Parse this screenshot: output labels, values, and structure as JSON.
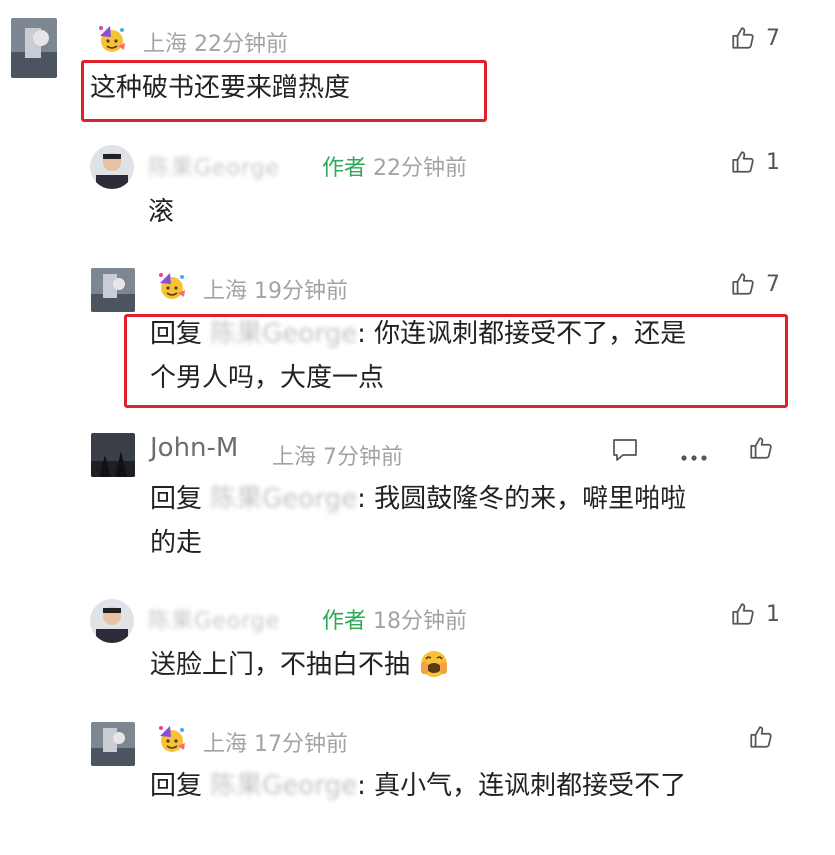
{
  "comments": [
    {
      "location": "上海",
      "time": "22分钟前",
      "text": "这种破书还要来蹭热度",
      "likes": "7"
    },
    {
      "name": "陈果George",
      "tag": "作者",
      "time": "22分钟前",
      "text": "滚",
      "likes": "1"
    },
    {
      "location": "上海",
      "time": "19分钟前",
      "reply_prefix": "回复",
      "reply_to": "陈果George",
      "text_line1": ": 你连讽刺都接受不了，还是",
      "text_line2": "个男人吗，大度一点",
      "likes": "7"
    },
    {
      "name": "John-M",
      "location": "上海",
      "time": "7分钟前",
      "reply_prefix": "回复",
      "reply_to": "陈果George",
      "text_line1": ": 我圆鼓隆冬的来，噼里啪啦",
      "text_line2": "的走"
    },
    {
      "name": "陈果George",
      "tag": "作者",
      "time": "18分钟前",
      "text": "送脸上门，不抽白不抽",
      "likes": "1"
    },
    {
      "location": "上海",
      "time": "17分钟前",
      "reply_prefix": "回复",
      "reply_to": "陈果George",
      "text": ": 真小气，连讽刺都接受不了"
    }
  ],
  "icons": {
    "like": "thumbs-up-icon",
    "comment": "comment-icon",
    "more": "more-dots-icon",
    "emoji": "grimacing-face-emoji",
    "badge": "party-face-badge"
  },
  "colors": {
    "highlight": "#e0202a",
    "author_tag": "#2eaa57"
  }
}
